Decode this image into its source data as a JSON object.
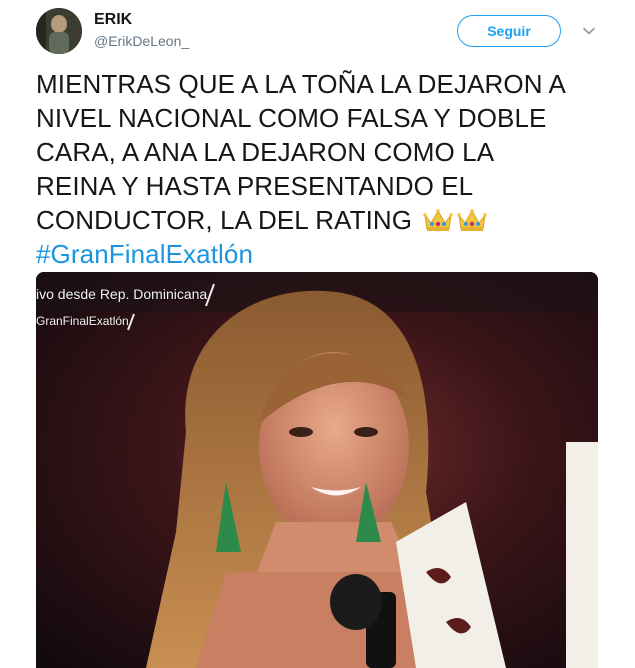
{
  "user": {
    "display_name": "ERIK",
    "handle": "@ErikDeLeon_"
  },
  "follow_button": {
    "label": "Seguir"
  },
  "tweet": {
    "lines": [
      "MIENTRAS QUE A LA TOÑA LA DEJARON A",
      "NIVEL NACIONAL COMO FALSA Y DOBLE",
      "CARA, A ANA LA DEJARON COMO LA",
      "REINA Y HASTA PRESENTANDO EL",
      "CONDUCTOR, LA DEL RATING"
    ],
    "emoji": [
      "crown-icon",
      "crown-icon"
    ],
    "hashtag": "#GranFinalExatlón"
  },
  "media": {
    "overlay_line1": "ivo desde Rep. Dominicana",
    "overlay_line2": "GranFinalExatlón"
  },
  "colors": {
    "accent": "#1da1f2",
    "hashtag": "#1b95e0",
    "text": "#14171a",
    "secondary": "#657786"
  }
}
